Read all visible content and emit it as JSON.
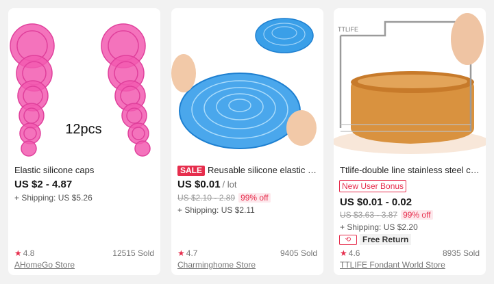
{
  "products": [
    {
      "image_label": "12pcs",
      "title": "Elastic silicone caps",
      "price": "US $2 - 4.87",
      "shipping": "+ Shipping: US $5.26",
      "rating": "4.8",
      "sold": "12515 Sold",
      "store": "AHomeGo Store"
    },
    {
      "sale_badge": "SALE",
      "title": "Reusable silicone elastic lids",
      "price": "US $0.01",
      "price_unit": "/ lot",
      "old_price": "US $2.10 - 2.89",
      "discount": "99% off",
      "shipping": "+ Shipping: US $2.11",
      "rating": "4.7",
      "sold": "9405 Sold",
      "store": "Charminghome Store"
    },
    {
      "brand_watermark": "TTLIFE",
      "title": "Ttlife-double line stainless steel cake cutter",
      "bonus": "New User Bonus",
      "price": "US $0.01 - 0.02",
      "old_price": "US $3.63 - 3.87",
      "discount": "99% off",
      "shipping": "+ Shipping: US $2.20",
      "free_return": "Free Return",
      "rating": "4.6",
      "sold": "8935 Sold",
      "store": "TTLIFE Fondant World Store"
    }
  ],
  "colors": {
    "accent": "#e62e4d",
    "lid_pink": "#f25bb0",
    "lid_blue": "#3a9fe8",
    "cake": "#d9923f",
    "background": "#f2f2f2"
  },
  "icons": {
    "star": "star-icon",
    "free_return": "free-return-icon"
  }
}
